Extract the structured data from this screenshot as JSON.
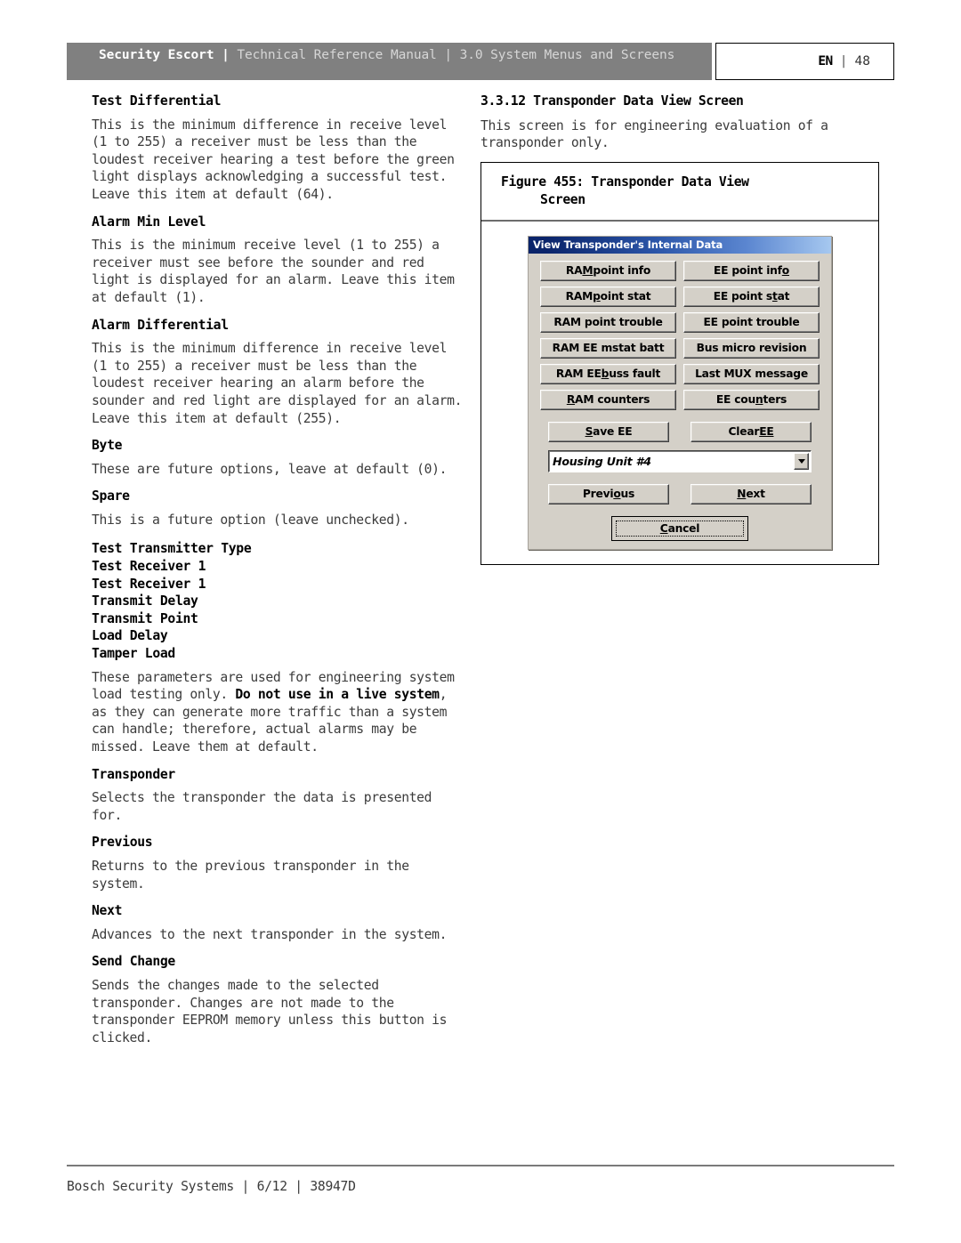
{
  "header": {
    "brand": "Security Escort",
    "divider": " | ",
    "rest": "Technical Reference Manual | 3.0  System Menus and Screens",
    "language": "EN",
    "separator": "|",
    "page_number": "48"
  },
  "left_column": {
    "blocks": [
      {
        "heading": "Test Differential",
        "body": "This is the minimum difference in receive level (1 to 255) a receiver must be less than the loudest receiver hearing a test before the green light displays acknowledging a successful test. Leave this item at default (64)."
      },
      {
        "heading": "Alarm Min Level",
        "body": "This is the minimum receive level (1 to 255) a receiver must see before the sounder and red light is displayed for an alarm. Leave this item at default (1)."
      },
      {
        "heading": "Alarm Differential",
        "body": "This is the minimum difference in receive level (1 to 255) a receiver must be less than the loudest receiver hearing an alarm before the sounder and red light are displayed for an alarm. Leave this item at default (255)."
      },
      {
        "heading": "Byte",
        "body": "These are future options, leave at default (0)."
      },
      {
        "heading": "Spare",
        "body": "This is a future option (leave unchecked)."
      }
    ],
    "stacked_headings": [
      "Test Transmitter Type",
      "Test Receiver 1",
      "Test Receiver 1",
      "Transmit Delay",
      "Transmit Point",
      "Load Delay",
      "Tamper Load"
    ],
    "stacked_body_part1": "These parameters are used for engineering system load testing only. ",
    "stacked_body_bold": "Do not use in a live system",
    "stacked_body_part2": ", as they can generate more traffic than a system can handle; therefore, actual alarms may be missed. Leave them at default.",
    "blocks2": [
      {
        "heading": "Transponder",
        "body": "Selects the transponder the data is presented for."
      },
      {
        "heading": "Previous",
        "body": "Returns to the previous transponder in the system."
      },
      {
        "heading": "Next",
        "body": "Advances to the next transponder in the system."
      },
      {
        "heading": "Send Change",
        "body": "Sends the changes made to the selected transponder. Changes are not made to the transponder EEPROM memory unless this button is clicked."
      }
    ]
  },
  "right_column": {
    "section_number": "3.3.12",
    "section_title": "Transponder Data View Screen",
    "intro": "This screen is for engineering evaluation of a transponder only.",
    "figure": {
      "caption_line1": "Figure 455: Transponder Data View",
      "caption_line2": "Screen"
    }
  },
  "dialog": {
    "title": "View Transponder's Internal Data",
    "buttons": [
      {
        "pre": "RA",
        "accel": "M",
        "post": " point info",
        "name": "ram-point-info-button"
      },
      {
        "pre": "EE point inf",
        "accel": "o",
        "post": "",
        "name": "ee-point-info-button"
      },
      {
        "pre": "RAM ",
        "accel": "p",
        "post": "oint stat",
        "name": "ram-point-stat-button"
      },
      {
        "pre": "EE point s",
        "accel": "t",
        "post": "at",
        "name": "ee-point-stat-button"
      },
      {
        "pre": "RAM point trouble",
        "accel": "",
        "post": "",
        "name": "ram-point-trouble-button"
      },
      {
        "pre": "EE point trouble",
        "accel": "",
        "post": "",
        "name": "ee-point-trouble-button"
      },
      {
        "pre": "RAM EE mstat batt",
        "accel": "",
        "post": "",
        "name": "ram-ee-mstat-batt-button"
      },
      {
        "pre": "Bus micro revision",
        "accel": "",
        "post": "",
        "name": "bus-micro-revision-button"
      },
      {
        "pre": "RAM EE ",
        "accel": "b",
        "post": "uss fault",
        "name": "ram-ee-buss-fault-button"
      },
      {
        "pre": "Last MUX message",
        "accel": "",
        "post": "",
        "name": "last-mux-message-button"
      },
      {
        "pre": "",
        "accel": "R",
        "post": "AM counters",
        "name": "ram-counters-button"
      },
      {
        "pre": "EE cou",
        "accel": "n",
        "post": "ters",
        "name": "ee-counters-button"
      }
    ],
    "save_ee": {
      "pre": "",
      "accel": "S",
      "post": "ave EE"
    },
    "clear_ee": {
      "pre": "Clear ",
      "accel": "EE",
      "post": ""
    },
    "combo_value": "Housing Unit #4",
    "combo_icon": "chevron-down-icon",
    "previous": {
      "pre": "Previ",
      "accel": "o",
      "post": "us"
    },
    "next": {
      "pre": "",
      "accel": "N",
      "post": "ext"
    },
    "cancel": {
      "pre": "",
      "accel": "C",
      "post": "ancel"
    }
  },
  "footer": {
    "text": "Bosch Security Systems | 6/12 | 38947D"
  }
}
